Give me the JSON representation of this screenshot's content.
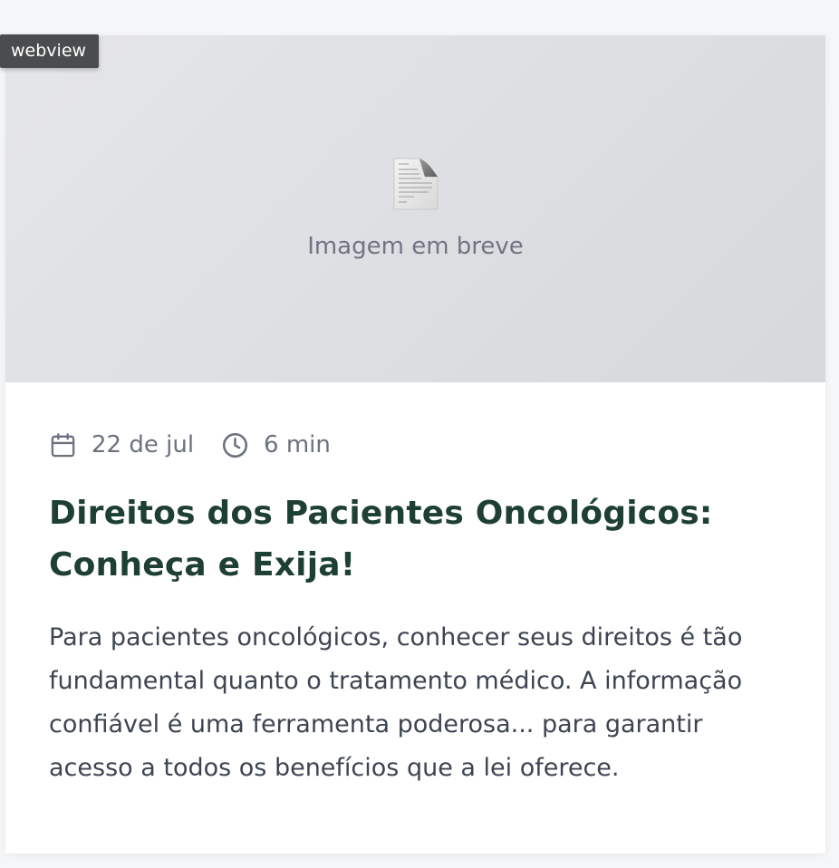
{
  "badge": {
    "label": "webview"
  },
  "card": {
    "image_placeholder": {
      "icon": "document-icon",
      "text": "Imagem em breve"
    },
    "meta": {
      "date": {
        "icon": "calendar-icon",
        "text": "22 de jul"
      },
      "read_time": {
        "icon": "clock-icon",
        "text": "6 min"
      }
    },
    "title": "Direitos dos Pacientes Oncológicos: Conheça e Exija!",
    "excerpt": "Para pacientes oncológicos, conhecer seus direitos é tão fundamental quanto o tratamento médico. A informação confiável é uma ferramenta poderosa... para garantir acesso a todos os benefícios que a lei oferece."
  },
  "colors": {
    "title": "#1e3f33",
    "meta": "#6b7280",
    "body": "#3d4452",
    "image_bg": "#dcdde1",
    "badge_bg": "#4a4c4e"
  }
}
